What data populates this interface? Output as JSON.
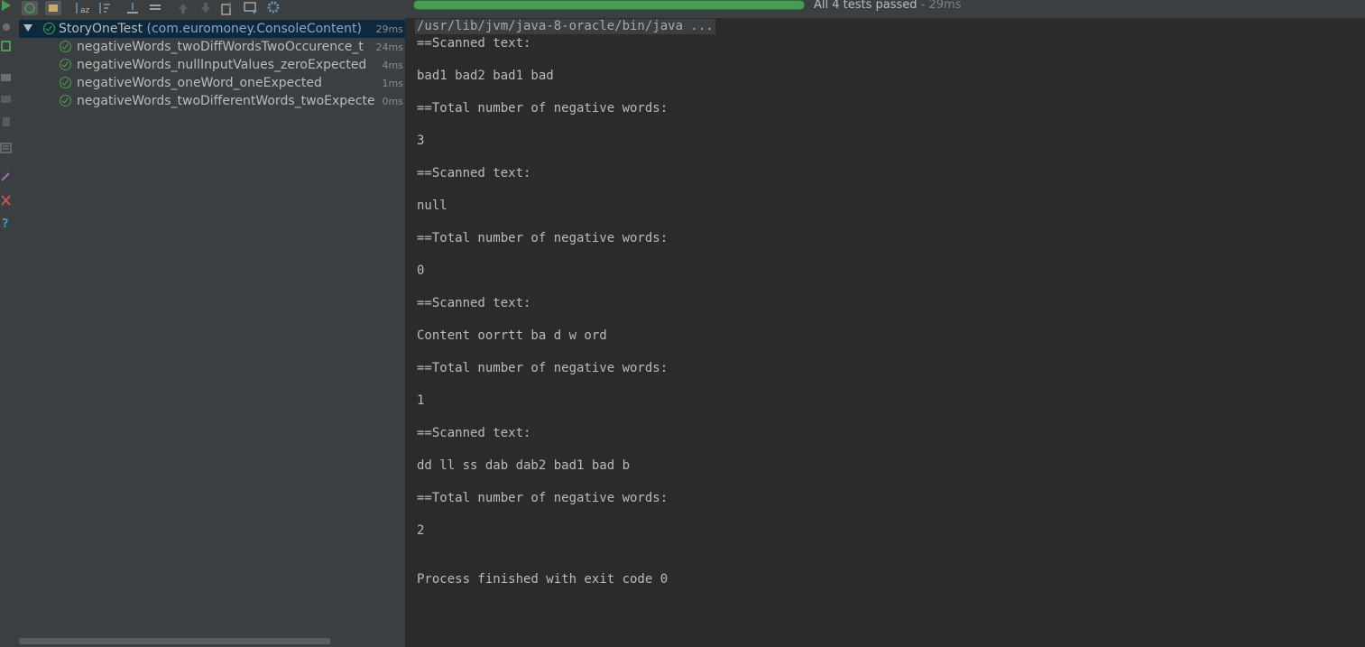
{
  "progress": {
    "summary": "All 4 tests passed",
    "duration": " - 29ms",
    "fraction": 1.0
  },
  "tree": {
    "root": {
      "name": "StoryOneTest",
      "package": " (com.euromoney.ConsoleContent)",
      "time": "29ms"
    },
    "tests": [
      {
        "name": "negativeWords_twoDiffWordsTwoOccurence_t",
        "time": "24ms"
      },
      {
        "name": "negativeWords_nullInputValues_zeroExpected",
        "time": "4ms"
      },
      {
        "name": "negativeWords_oneWord_oneExpected",
        "time": "1ms"
      },
      {
        "name": "negativeWords_twoDifferentWords_twoExpecte",
        "time": "0ms"
      }
    ]
  },
  "console": {
    "command": "/usr/lib/jvm/java-8-oracle/bin/java ...",
    "lines": [
      "==Scanned text:",
      "bad1 bad2 bad1 bad",
      "==Total number of negative words:",
      "3",
      "==Scanned text:",
      "null",
      "==Total number of negative words:",
      "0",
      "==Scanned text:",
      "Content oorrtt ba d w ord",
      "==Total number of negative words:",
      "1",
      "==Scanned text:",
      "dd ll ss dab dab2 bad1 bad b",
      "==Total number of negative words:",
      "2"
    ],
    "exit_line": "Process finished with exit code 0"
  },
  "colors": {
    "pass": "#499c54",
    "panel": "#3c3f41",
    "console_bg": "#2b2b2b",
    "text": "#bbbbbb",
    "package": "#8da5c9"
  }
}
